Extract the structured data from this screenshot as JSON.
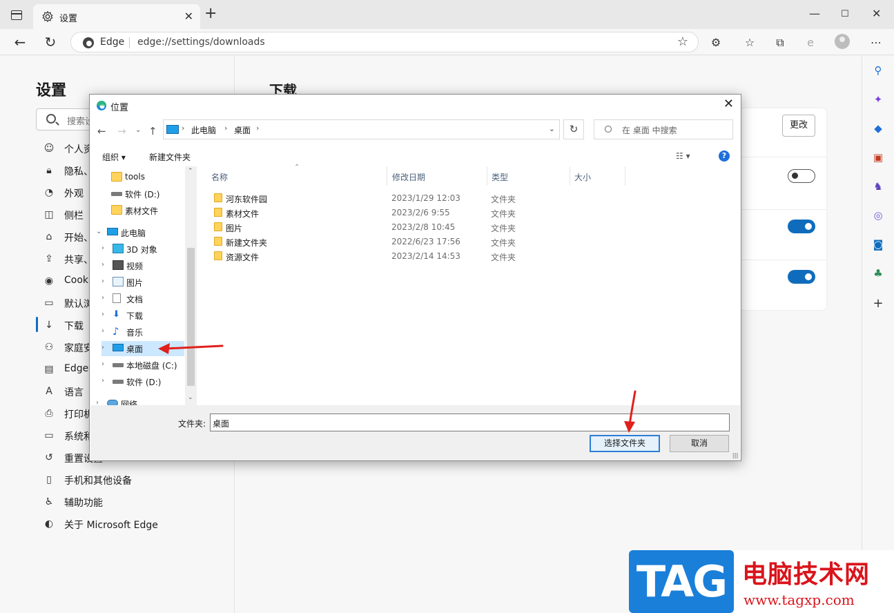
{
  "tab": {
    "title": "设置"
  },
  "address": {
    "brand": "Edge",
    "url": "edge://settings/downloads"
  },
  "settings": {
    "title": "设置",
    "search_placeholder": "搜索设",
    "content_title": "下载",
    "change_label": "更改",
    "menu": [
      {
        "icon": "person-icon",
        "label": "个人资"
      },
      {
        "icon": "lock-icon",
        "label": "隐私、"
      },
      {
        "icon": "palette-icon",
        "label": "外观"
      },
      {
        "icon": "sidebar-icon",
        "label": "侧栏"
      },
      {
        "icon": "start-page-icon",
        "label": "开始、"
      },
      {
        "icon": "share-icon",
        "label": "共享、"
      },
      {
        "icon": "cookie-icon",
        "label": "Cook"
      },
      {
        "icon": "browser-icon",
        "label": "默认浏"
      },
      {
        "icon": "download-icon",
        "label": "下载"
      },
      {
        "icon": "family-icon",
        "label": "家庭安"
      },
      {
        "icon": "edge-bar-icon",
        "label": "Edge"
      },
      {
        "icon": "language-icon",
        "label": "语言"
      },
      {
        "icon": "printer-icon",
        "label": "打印机"
      },
      {
        "icon": "system-icon",
        "label": "系统和"
      },
      {
        "icon": "reset-icon",
        "label": "重置设置"
      },
      {
        "icon": "phone-icon",
        "label": "手机和其他设备"
      },
      {
        "icon": "accessibility-icon",
        "label": "辅助功能"
      },
      {
        "icon": "edge-logo-icon",
        "label": "关于 Microsoft Edge"
      }
    ],
    "toggles": [
      false,
      true,
      true
    ]
  },
  "dialog": {
    "title": "位置",
    "breadcrumb": [
      "此电脑",
      "桌面"
    ],
    "search_placeholder": "在 桌面 中搜索",
    "cmd_organize": "组织 ▾",
    "cmd_new_folder": "新建文件夹",
    "help": "?",
    "columns": [
      "名称",
      "修改日期",
      "类型",
      "大小"
    ],
    "tree": [
      {
        "label": "tools",
        "icon": "folder-icon",
        "indent": 2,
        "chev": ""
      },
      {
        "label": "软件 (D:)",
        "icon": "drive-icon",
        "indent": 2,
        "chev": ""
      },
      {
        "label": "素材文件",
        "icon": "folder-icon",
        "indent": 2,
        "chev": ""
      },
      {
        "label": "此电脑",
        "icon": "pc-icon",
        "indent": 0,
        "chev": "⌄"
      },
      {
        "label": "3D 对象",
        "icon": "3d-objects-icon",
        "indent": 1,
        "chev": "›"
      },
      {
        "label": "视频",
        "icon": "video-icon",
        "indent": 1,
        "chev": "›"
      },
      {
        "label": "图片",
        "icon": "picture-icon",
        "indent": 1,
        "chev": "›"
      },
      {
        "label": "文档",
        "icon": "document-icon",
        "indent": 1,
        "chev": "›"
      },
      {
        "label": "下载",
        "icon": "download-icon",
        "indent": 1,
        "chev": "›"
      },
      {
        "label": "音乐",
        "icon": "music-icon",
        "indent": 1,
        "chev": "›"
      },
      {
        "label": "桌面",
        "icon": "desktop-icon",
        "indent": 1,
        "chev": "›"
      },
      {
        "label": "本地磁盘 (C:)",
        "icon": "drive-icon",
        "indent": 1,
        "chev": "›"
      },
      {
        "label": "软件 (D:)",
        "icon": "drive-icon",
        "indent": 1,
        "chev": "›"
      },
      {
        "label": "网络",
        "icon": "network-icon",
        "indent": 0,
        "chev": "›"
      }
    ],
    "selected_tree": "桌面",
    "files": [
      {
        "name": "河东软件园",
        "date": "2023/1/29 12:03",
        "type": "文件夹"
      },
      {
        "name": "素材文件",
        "date": "2023/2/6 9:55",
        "type": "文件夹"
      },
      {
        "name": "图片",
        "date": "2023/2/8 10:45",
        "type": "文件夹"
      },
      {
        "name": "新建文件夹",
        "date": "2022/6/23 17:56",
        "type": "文件夹"
      },
      {
        "name": "资源文件",
        "date": "2023/2/14 14:53",
        "type": "文件夹"
      }
    ],
    "folder_label": "文件夹:",
    "folder_value": "桌面",
    "select_button": "选择文件夹",
    "cancel_button": "取消"
  },
  "watermark": {
    "tag": "TAG",
    "cn": "电脑技术网",
    "url": "www.tagxp.com"
  },
  "colors": {
    "accent": "#0f6cbd",
    "annotation": "#e0201c",
    "selection": "#cce8ff"
  }
}
